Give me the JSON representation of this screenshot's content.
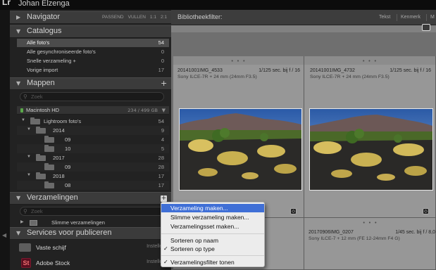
{
  "app": {
    "logo": "Lr",
    "username": "Johan Elzenga"
  },
  "left": {
    "navigator": {
      "title": "Navigator",
      "options": [
        "PASSEND",
        "VULLEN",
        "1:1",
        "2:1"
      ]
    },
    "catalog": {
      "title": "Catalogus",
      "items": [
        {
          "label": "Alle foto's",
          "count": "54"
        },
        {
          "label": "Alle gesynchroniseerde foto's",
          "count": "0"
        },
        {
          "label": "Snelle verzameling +",
          "count": "0"
        },
        {
          "label": "Vorige import",
          "count": "17"
        }
      ]
    },
    "folders": {
      "title": "Mappen",
      "add": "+",
      "search_placeholder": "Zoek",
      "volume": {
        "name": "Macintosh HD",
        "capacity": "234 / 499 GB"
      },
      "rows": [
        {
          "name": "Lightroom foto's",
          "count": "54"
        },
        {
          "name": "2014",
          "count": "9"
        },
        {
          "name": "09",
          "count": "4"
        },
        {
          "name": "10",
          "count": "5"
        },
        {
          "name": "2017",
          "count": "28"
        },
        {
          "name": "09",
          "count": "28"
        },
        {
          "name": "2018",
          "count": "17"
        },
        {
          "name": "08",
          "count": "17"
        }
      ]
    },
    "collections": {
      "title": "Verzamelingen",
      "add": "+",
      "search_placeholder": "Zoek",
      "rows": [
        {
          "name": "Slimme verzamelingen"
        }
      ]
    },
    "publish": {
      "title": "Services voor publiceren",
      "add": "+",
      "rows": [
        {
          "name": "Vaste schijf",
          "action": "Instellen..."
        },
        {
          "name": "Adobe Stock",
          "action": "Instellen..."
        }
      ]
    }
  },
  "filterbar": {
    "title": "Bibliotheekfilter:",
    "tabs": [
      "Tekst",
      "Kenmerk",
      "M"
    ]
  },
  "grid": {
    "cells": [
      {
        "filename": "20141001IMG_4533",
        "shutter": "1/125 sec. bij f / 16",
        "lens": "Sony ILCE-7R + 24 mm (24mm F3.5)"
      },
      {
        "filename": "20141001IMG_4732",
        "shutter": "1/125 sec. bij f / 16",
        "lens": "Sony ILCE-7R + 24 mm (24mm F3.5)"
      },
      {
        "filename": "20170906IMG_0207",
        "shutter": "1/45 sec. bij f / 8,0",
        "lens": "Sony ILCE-7 + 12 mm (FE 12-24mm F4 G)"
      }
    ],
    "dots": "• • •"
  },
  "context_menu": {
    "items": [
      {
        "label": "Verzameling maken...",
        "highlighted": true,
        "checked": false
      },
      {
        "label": "Slimme verzameling maken...",
        "highlighted": false,
        "checked": false
      },
      {
        "label": "Verzamelingsset maken...",
        "highlighted": false,
        "checked": false
      },
      {
        "label": "Sorteren op naam",
        "highlighted": false,
        "checked": false
      },
      {
        "label": "Sorteren op type",
        "highlighted": false,
        "checked": true
      },
      {
        "label": "Verzamelingsfilter tonen",
        "highlighted": false,
        "checked": true
      }
    ],
    "check_glyph": "✓"
  },
  "colors": {
    "highlight": "#3f6fd6",
    "panel": "#2a2a2a",
    "grid_cell": "#979797"
  }
}
